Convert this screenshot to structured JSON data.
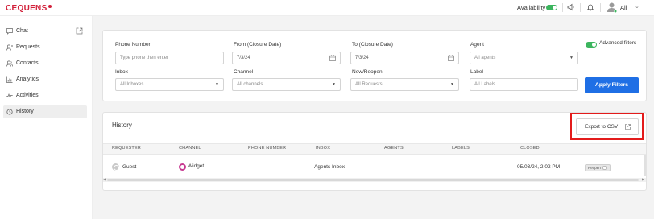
{
  "header": {
    "logo": "CEQUENS",
    "availability_label": "Availability",
    "availability_on": true,
    "user_name": "Ali",
    "user_chevron": "⌄",
    "icons": [
      "sound-icon",
      "bell-icon",
      "user-avatar-icon"
    ]
  },
  "sidebar": {
    "items": [
      {
        "label": "Chat",
        "icon": "chat-icon",
        "external": true
      },
      {
        "label": "Requests",
        "icon": "requests-icon"
      },
      {
        "label": "Contacts",
        "icon": "contacts-icon"
      },
      {
        "label": "Analytics",
        "icon": "analytics-icon"
      },
      {
        "label": "Activities",
        "icon": "activities-icon"
      },
      {
        "label": "History",
        "icon": "history-icon",
        "active": true
      }
    ]
  },
  "filters": {
    "phone": {
      "label": "Phone Number",
      "placeholder": "Type phone then enter"
    },
    "from": {
      "label": "From (Closure Date)",
      "value": "7/3/24"
    },
    "to": {
      "label": "To (Closure Date)",
      "value": "7/3/24"
    },
    "agent": {
      "label": "Agent",
      "placeholder": "All agents"
    },
    "inbox": {
      "label": "Inbox",
      "value": "All Inboxes"
    },
    "channel": {
      "label": "Channel",
      "value": "All channels"
    },
    "new_reopen": {
      "label": "New/Reopen",
      "value": "All Requests"
    },
    "label": {
      "label": "Label",
      "placeholder": "All Labels"
    },
    "advanced_label": "Advanced filters",
    "advanced_on": true,
    "apply_label": "Apply Filters",
    "chevron": "▼"
  },
  "history": {
    "title": "History",
    "export_label": "Export to CSV",
    "columns": [
      "REQUESTER",
      "CHANNEL",
      "PHONE NUMBER",
      "INBOX",
      "AGENTS",
      "LABELS",
      "CLOSED"
    ],
    "rows": [
      {
        "requester": "Guest",
        "channel": "Widget",
        "phone": "",
        "inbox": "Agents Inbox",
        "agents": "",
        "labels": "",
        "closed": "05/03/24, 2:02 PM",
        "badge": "Reopen"
      }
    ]
  },
  "colors": {
    "brand_red": "#d2203a",
    "primary_blue": "#1f6fe5",
    "toggle_green": "#3cb55e",
    "highlight_red": "#e31b1b",
    "widget_magenta": "#c73a91"
  }
}
